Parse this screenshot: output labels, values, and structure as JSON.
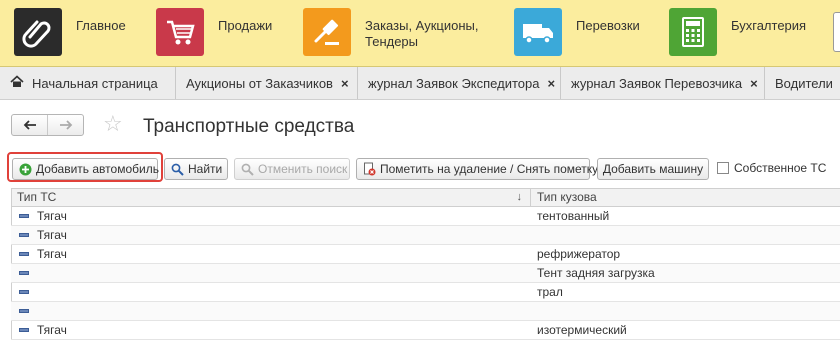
{
  "sections": [
    {
      "label": "Главное",
      "icon": "paperclip-icon",
      "color": "#2b2b2b"
    },
    {
      "label": "Продажи",
      "icon": "shopping-cart-icon",
      "color": "#c9394a"
    },
    {
      "label": "Заказы,  Аукционы,\nТендеры",
      "icon": "gavel-icon",
      "color": "#f39a1d"
    },
    {
      "label": "Перевозки",
      "icon": "truck-icon",
      "color": "#3ba9d9"
    },
    {
      "label": "Бухгалтерия",
      "icon": "calculator-icon",
      "color": "#4fa535"
    }
  ],
  "tabs": [
    {
      "label": "Начальная страница",
      "closable": false
    },
    {
      "label": "Аукционы от Заказчиков",
      "closable": true
    },
    {
      "label": "журнал Заявок Экспедитора",
      "closable": true
    },
    {
      "label": "журнал Заявок Перевозчика",
      "closable": true
    },
    {
      "label": "Водители",
      "closable": false
    }
  ],
  "form": {
    "title": "Транспортные средства",
    "back_icon": "arrow-left-icon",
    "forward_icon": "arrow-right-icon",
    "favorite_icon": "star-icon"
  },
  "commands": {
    "add_car": "Добавить автомобиль",
    "find": "Найти",
    "cancel_search": "Отменить поиск",
    "mark_delete": "Пометить на удаление / Снять пометку",
    "add_machine": "Добавить машину",
    "own_vehicle": "Собственное ТС"
  },
  "table": {
    "columns": [
      "Тип ТС",
      "Тип кузова"
    ],
    "sort_indicator": "↓",
    "rows": [
      {
        "type": "Тягач",
        "body": "тентованный"
      },
      {
        "type": "Тягач",
        "body": ""
      },
      {
        "type": "Тягач",
        "body": "рефрижератор"
      },
      {
        "type": "",
        "body": "Тент задняя загрузка"
      },
      {
        "type": "",
        "body": "трал"
      },
      {
        "type": "",
        "body": ""
      },
      {
        "type": "Тягач",
        "body": "изотермический"
      }
    ]
  },
  "colors": {
    "sections_bg": "#fbed9e",
    "highlight": "#e0413a"
  }
}
